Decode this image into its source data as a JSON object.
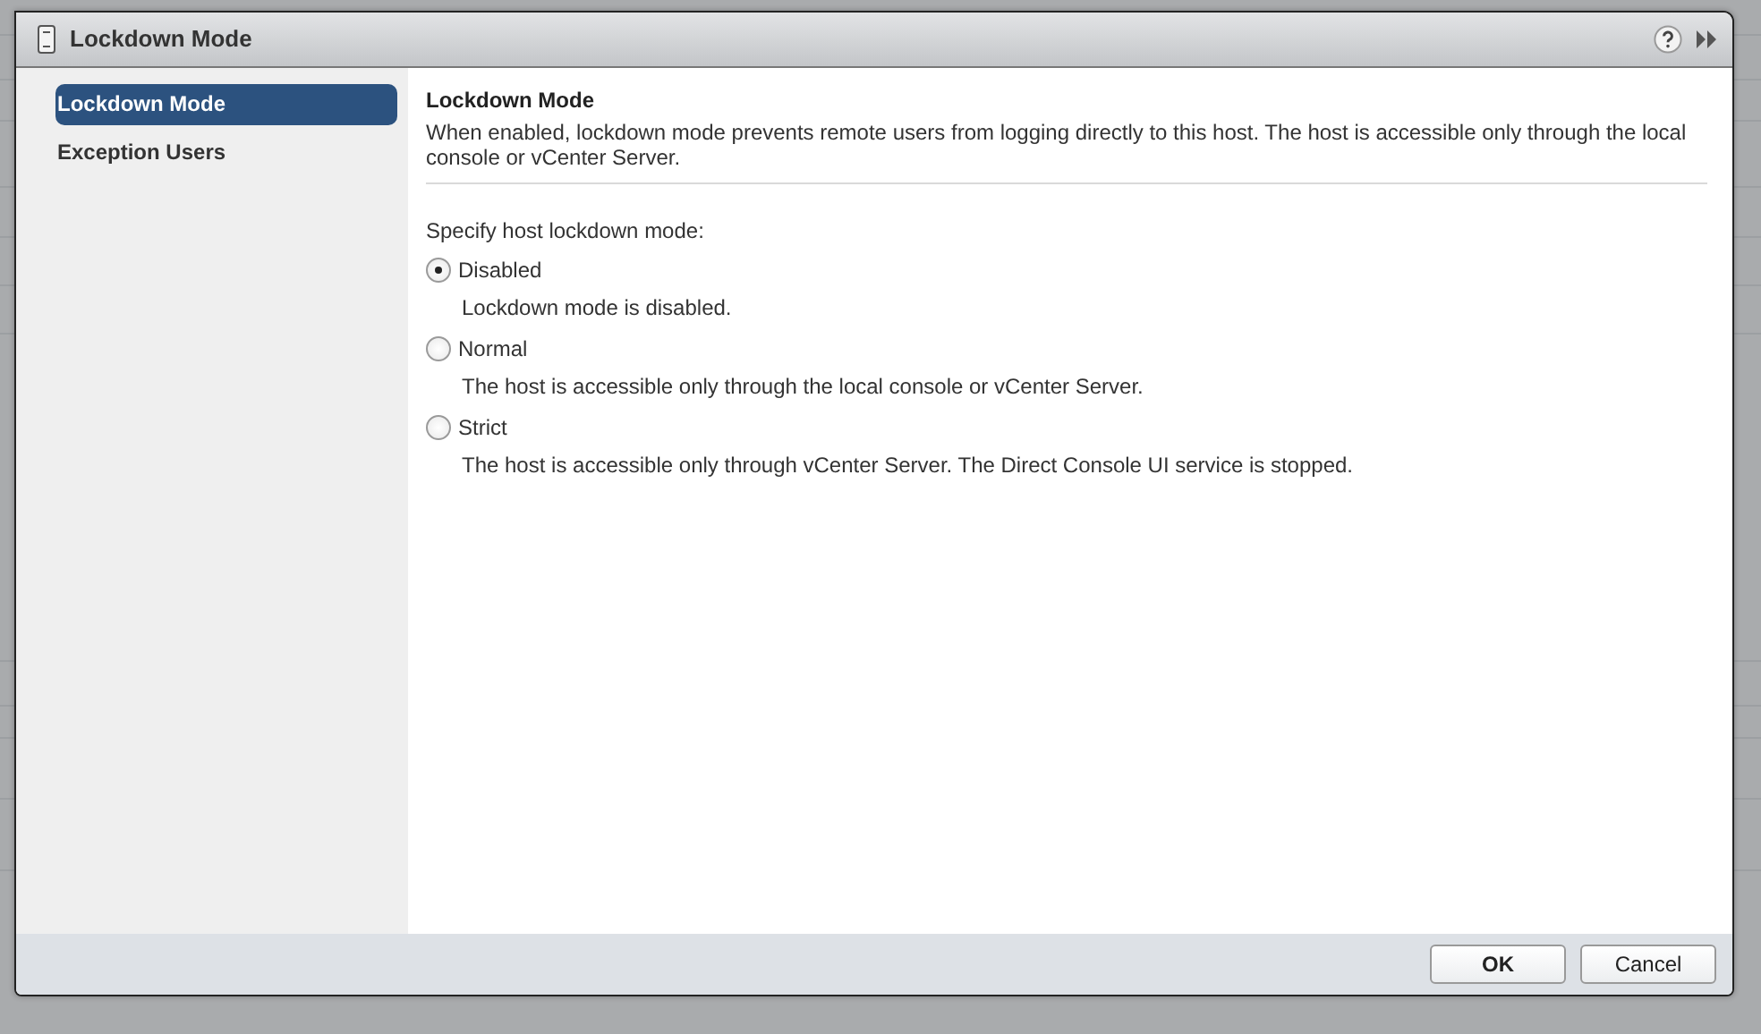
{
  "dialog": {
    "title": "Lockdown Mode",
    "sidebar": {
      "items": [
        {
          "label": "Lockdown Mode",
          "selected": true
        },
        {
          "label": "Exception Users",
          "selected": false
        }
      ]
    },
    "heading": "Lockdown Mode",
    "description": "When enabled, lockdown mode prevents remote users from logging directly to this host. The host is accessible only through the local console or vCenter Server.",
    "prompt": "Specify host lockdown mode:",
    "options": [
      {
        "label": "Disabled",
        "note": "Lockdown mode is disabled.",
        "selected": true
      },
      {
        "label": "Normal",
        "note": "The host is accessible only through the local console or vCenter Server.",
        "selected": false
      },
      {
        "label": "Strict",
        "note": "The host is accessible only through vCenter Server. The Direct Console UI service is stopped.",
        "selected": false
      }
    ],
    "buttons": [
      "OK",
      "Cancel"
    ]
  }
}
